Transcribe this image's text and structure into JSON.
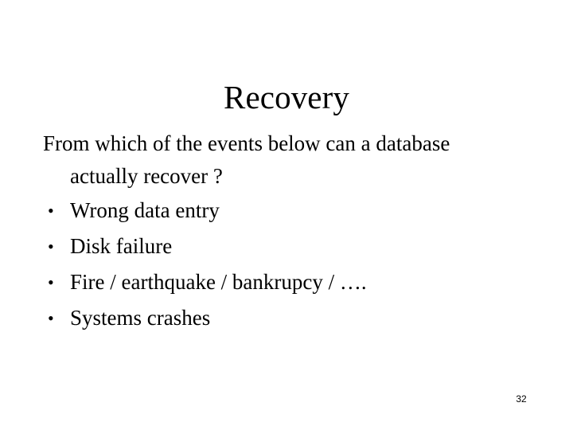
{
  "slide": {
    "title": "Recovery",
    "intro": "From which of the events below can a database actually recover ?",
    "bullet_marker": "•",
    "bullets": [
      {
        "text": "Wrong data entry"
      },
      {
        "text": "Disk failure"
      },
      {
        "text": "Fire / earthquake / bankrupcy / …."
      },
      {
        "text": "Systems crashes"
      }
    ],
    "slide_number": "32",
    "colors": {
      "background": "#ffffff",
      "text": "#000000"
    }
  }
}
